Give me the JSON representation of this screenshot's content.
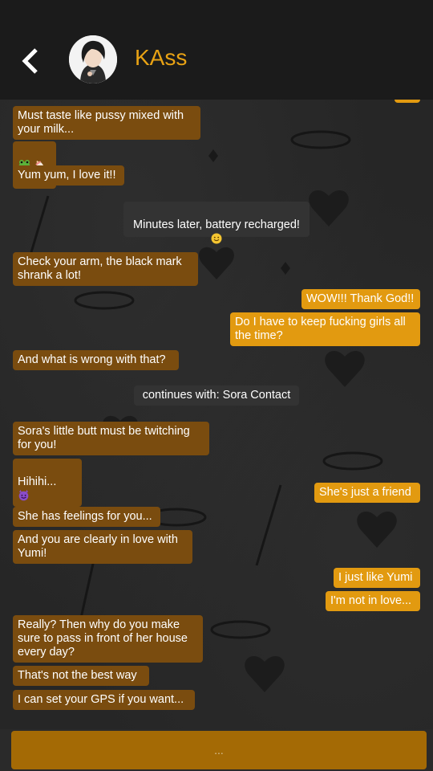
{
  "header": {
    "contact_name": "KAss",
    "back_icon": "chevron-left-icon",
    "avatar_icon": "avatar"
  },
  "colors": {
    "accent": "#e8a214",
    "incoming_bubble": "#7a4c0f",
    "outgoing_bubble": "#e29a10",
    "system_bubble": "#333333",
    "input_bar": "#a46a05"
  },
  "messages": [
    {
      "type": "in",
      "text": "Must taste like pussy mixed with\nyour milk..."
    },
    {
      "type": "in",
      "emojis": [
        "frog-icon",
        "baby-bottle-icon"
      ]
    },
    {
      "type": "in",
      "text": "Yum yum, I love it!!"
    },
    {
      "type": "system",
      "text": "Minutes later, battery recharged!",
      "emoji": "smiling-face-icon"
    },
    {
      "type": "in",
      "text": "Check your arm, the black mark\nshrank a lot!"
    },
    {
      "type": "out",
      "text": "WOW!!! Thank God!!"
    },
    {
      "type": "out",
      "text": "Do I have to keep fucking girls all\nthe time?"
    },
    {
      "type": "in",
      "text": "And what is wrong with that?"
    },
    {
      "type": "system",
      "text": "continues with: Sora Contact"
    },
    {
      "type": "in",
      "text": "Sora's little butt must be twitching\nfor you!"
    },
    {
      "type": "in",
      "text": "Hihihi...",
      "emoji": "smiling-devil-icon"
    },
    {
      "type": "out",
      "text": "She's just a friend"
    },
    {
      "type": "in",
      "text": "She has feelings for you..."
    },
    {
      "type": "in",
      "text": "And you are clearly in love with\nYumi!"
    },
    {
      "type": "out",
      "text": "I just like Yumi"
    },
    {
      "type": "out",
      "text": "I'm not in love..."
    },
    {
      "type": "in",
      "text": "Really? Then why do you make\nsure to pass in front of her house\nevery day?"
    },
    {
      "type": "in",
      "text": "That's not the best way"
    },
    {
      "type": "in",
      "text": "I can set your GPS if you want..."
    }
  ],
  "input": {
    "placeholder": "..."
  }
}
